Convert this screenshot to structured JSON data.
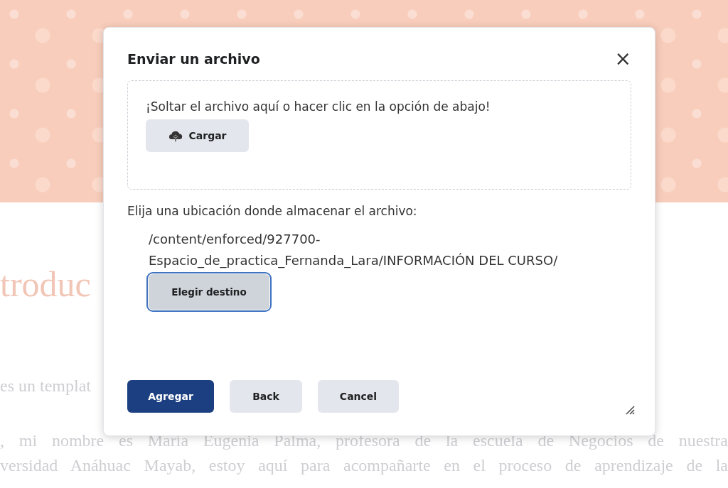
{
  "page": {
    "heading": "troduc",
    "intro": "es un templat",
    "paragraph_lines": [
      ", mi nombre es María Eugenia Palma, profesora de la escuela de Negocios de nuestra",
      "versidad Anáhuac Mayab, estoy aquí para acompañarte en el proceso de aprendizaje de la"
    ]
  },
  "dialog": {
    "title": "Enviar un archivo",
    "close": "×",
    "dropzone": {
      "message": "¡Soltar el archivo aquí o hacer clic en la opción de abajo!",
      "upload_button": "Cargar"
    },
    "location_label": "Elija una ubicación donde almacenar el archivo:",
    "path_lines": [
      "/content/enforced/927700-",
      "Espacio_de_practica_Fernanda_Lara/INFORMACIÓN DEL CURSO/"
    ],
    "choose_button": {
      "label": "Elegir destino",
      "focused": true
    },
    "buttons": [
      {
        "label": "Agregar",
        "kind": "primary"
      },
      {
        "label": "Back",
        "kind": "secondary"
      },
      {
        "label": "Cancel",
        "kind": "secondary"
      }
    ]
  }
}
